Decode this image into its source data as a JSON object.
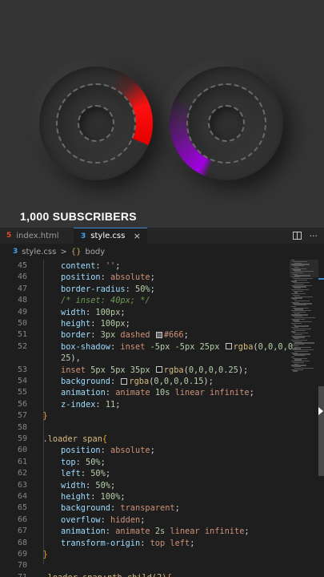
{
  "preview": {
    "caption": "1,000 SUBSCRIBERS",
    "colors": {
      "left_arc": "#ff0000",
      "right_arc": "#9f00e0"
    }
  },
  "tabs": [
    {
      "label": "index.html",
      "icon": "html5-icon",
      "active": false
    },
    {
      "label": "style.css",
      "icon": "css3-icon",
      "active": true,
      "close": "×"
    }
  ],
  "breadcrumb": {
    "file": "style.css",
    "separator": ">",
    "symbol": "body"
  },
  "code": {
    "lines": [
      {
        "num": "45",
        "indent": 2,
        "tokens": [
          {
            "t": "content",
            "c": "p"
          },
          {
            "t": ": ",
            "c": "w"
          },
          {
            "t": "''",
            "c": "v"
          },
          {
            "t": ";",
            "c": "w"
          }
        ]
      },
      {
        "num": "46",
        "indent": 2,
        "tokens": [
          {
            "t": "position",
            "c": "p"
          },
          {
            "t": ": ",
            "c": "w"
          },
          {
            "t": "absolute",
            "c": "v"
          },
          {
            "t": ";",
            "c": "w"
          }
        ]
      },
      {
        "num": "47",
        "indent": 2,
        "tokens": [
          {
            "t": "border-radius",
            "c": "p"
          },
          {
            "t": ": ",
            "c": "w"
          },
          {
            "t": "50%",
            "c": "n"
          },
          {
            "t": ";",
            "c": "w"
          }
        ]
      },
      {
        "num": "48",
        "indent": 2,
        "tokens": [
          {
            "t": "/* inset: 40px; */",
            "c": "c"
          }
        ]
      },
      {
        "num": "49",
        "indent": 2,
        "tokens": [
          {
            "t": "width",
            "c": "p"
          },
          {
            "t": ": ",
            "c": "w"
          },
          {
            "t": "100px",
            "c": "n"
          },
          {
            "t": ";",
            "c": "w"
          }
        ]
      },
      {
        "num": "50",
        "indent": 2,
        "tokens": [
          {
            "t": "height",
            "c": "p"
          },
          {
            "t": ": ",
            "c": "w"
          },
          {
            "t": "100px",
            "c": "n"
          },
          {
            "t": ";",
            "c": "w"
          }
        ]
      },
      {
        "num": "51",
        "indent": 2,
        "tokens": [
          {
            "t": "border",
            "c": "p"
          },
          {
            "t": ": ",
            "c": "w"
          },
          {
            "t": "3px",
            "c": "n"
          },
          {
            "t": " dashed ",
            "c": "v"
          },
          {
            "sw": "#666"
          },
          {
            "t": "#666",
            "c": "v"
          },
          {
            "t": ";",
            "c": "w"
          }
        ]
      },
      {
        "num": "52",
        "indent": 2,
        "tokens": [
          {
            "t": "box-shadow",
            "c": "p"
          },
          {
            "t": ": ",
            "c": "w"
          },
          {
            "t": "inset ",
            "c": "v"
          },
          {
            "t": "-5px -5px 25px ",
            "c": "n"
          },
          {
            "sw": "rgba(0,0,0,0)"
          },
          {
            "t": "rgba",
            "c": "s"
          },
          {
            "t": "(",
            "c": "w"
          },
          {
            "t": "0,0,0,0.",
            "c": "n"
          }
        ]
      },
      {
        "num": "",
        "indent": 0,
        "tokens": [
          {
            "t": "25",
            "c": "n"
          },
          {
            "t": "),",
            "c": "w"
          }
        ]
      },
      {
        "num": "53",
        "indent": 2,
        "tokens": [
          {
            "t": "inset ",
            "c": "v"
          },
          {
            "t": "5px 5px 35px ",
            "c": "n"
          },
          {
            "sw": "rgba(0,0,0,0.25)"
          },
          {
            "t": "rgba",
            "c": "s"
          },
          {
            "t": "(",
            "c": "w"
          },
          {
            "t": "0,0,0,0.25",
            "c": "n"
          },
          {
            "t": ");",
            "c": "w"
          }
        ]
      },
      {
        "num": "54",
        "indent": 2,
        "tokens": [
          {
            "t": "background",
            "c": "p"
          },
          {
            "t": ": ",
            "c": "w"
          },
          {
            "sw": "rgba(0,0,0,0.15)"
          },
          {
            "t": "rgba",
            "c": "s"
          },
          {
            "t": "(",
            "c": "w"
          },
          {
            "t": "0,0,0,0.15",
            "c": "n"
          },
          {
            "t": ");",
            "c": "w"
          }
        ]
      },
      {
        "num": "55",
        "indent": 2,
        "tokens": [
          {
            "t": "animation",
            "c": "p"
          },
          {
            "t": ": ",
            "c": "w"
          },
          {
            "t": "animate ",
            "c": "v"
          },
          {
            "t": "10s",
            "c": "n"
          },
          {
            "t": " linear infinite",
            "c": "v"
          },
          {
            "t": ";",
            "c": "w"
          }
        ]
      },
      {
        "num": "56",
        "indent": 2,
        "tokens": [
          {
            "t": "z-index",
            "c": "p"
          },
          {
            "t": ": ",
            "c": "w"
          },
          {
            "t": "11",
            "c": "n"
          },
          {
            "t": ";",
            "c": "w"
          }
        ]
      },
      {
        "num": "57",
        "indent": 1,
        "tokens": [
          {
            "t": "}",
            "c": "k"
          }
        ]
      },
      {
        "num": "58",
        "indent": 0,
        "tokens": []
      },
      {
        "num": "59",
        "indent": 1,
        "tokens": [
          {
            "t": ".loader span",
            "c": "s"
          },
          {
            "t": "{",
            "c": "k"
          }
        ]
      },
      {
        "num": "60",
        "indent": 2,
        "tokens": [
          {
            "t": "position",
            "c": "p"
          },
          {
            "t": ": ",
            "c": "w"
          },
          {
            "t": "absolute",
            "c": "v"
          },
          {
            "t": ";",
            "c": "w"
          }
        ]
      },
      {
        "num": "61",
        "indent": 2,
        "tokens": [
          {
            "t": "top",
            "c": "p"
          },
          {
            "t": ": ",
            "c": "w"
          },
          {
            "t": "50%",
            "c": "n"
          },
          {
            "t": ";",
            "c": "w"
          }
        ]
      },
      {
        "num": "62",
        "indent": 2,
        "tokens": [
          {
            "t": "left",
            "c": "p"
          },
          {
            "t": ": ",
            "c": "w"
          },
          {
            "t": "50%",
            "c": "n"
          },
          {
            "t": ";",
            "c": "w"
          }
        ]
      },
      {
        "num": "63",
        "indent": 2,
        "tokens": [
          {
            "t": "width",
            "c": "p"
          },
          {
            "t": ": ",
            "c": "w"
          },
          {
            "t": "50%",
            "c": "n"
          },
          {
            "t": ";",
            "c": "w"
          }
        ]
      },
      {
        "num": "64",
        "indent": 2,
        "tokens": [
          {
            "t": "height",
            "c": "p"
          },
          {
            "t": ": ",
            "c": "w"
          },
          {
            "t": "100%",
            "c": "n"
          },
          {
            "t": ";",
            "c": "w"
          }
        ]
      },
      {
        "num": "65",
        "indent": 2,
        "tokens": [
          {
            "t": "background",
            "c": "p"
          },
          {
            "t": ": ",
            "c": "w"
          },
          {
            "t": "transparent",
            "c": "v"
          },
          {
            "t": ";",
            "c": "w"
          }
        ]
      },
      {
        "num": "66",
        "indent": 2,
        "tokens": [
          {
            "t": "overflow",
            "c": "p"
          },
          {
            "t": ": ",
            "c": "w"
          },
          {
            "t": "hidden",
            "c": "v"
          },
          {
            "t": ";",
            "c": "w"
          }
        ]
      },
      {
        "num": "67",
        "indent": 2,
        "tokens": [
          {
            "t": "animation",
            "c": "p"
          },
          {
            "t": ": ",
            "c": "w"
          },
          {
            "t": "animate ",
            "c": "v"
          },
          {
            "t": "2s",
            "c": "n"
          },
          {
            "t": " linear infinite",
            "c": "v"
          },
          {
            "t": ";",
            "c": "w"
          }
        ]
      },
      {
        "num": "68",
        "indent": 2,
        "tokens": [
          {
            "t": "transform-origin",
            "c": "p"
          },
          {
            "t": ": ",
            "c": "w"
          },
          {
            "t": "top left",
            "c": "v"
          },
          {
            "t": ";",
            "c": "w"
          }
        ]
      },
      {
        "num": "69",
        "indent": 1,
        "tokens": [
          {
            "t": "}",
            "c": "k"
          }
        ]
      },
      {
        "num": "70",
        "indent": 0,
        "tokens": []
      },
      {
        "num": "71",
        "indent": 1,
        "tokens": [
          {
            "t": ".loader span:nth-child(2)",
            "c": "s"
          },
          {
            "t": "{",
            "c": "k"
          }
        ]
      }
    ]
  }
}
